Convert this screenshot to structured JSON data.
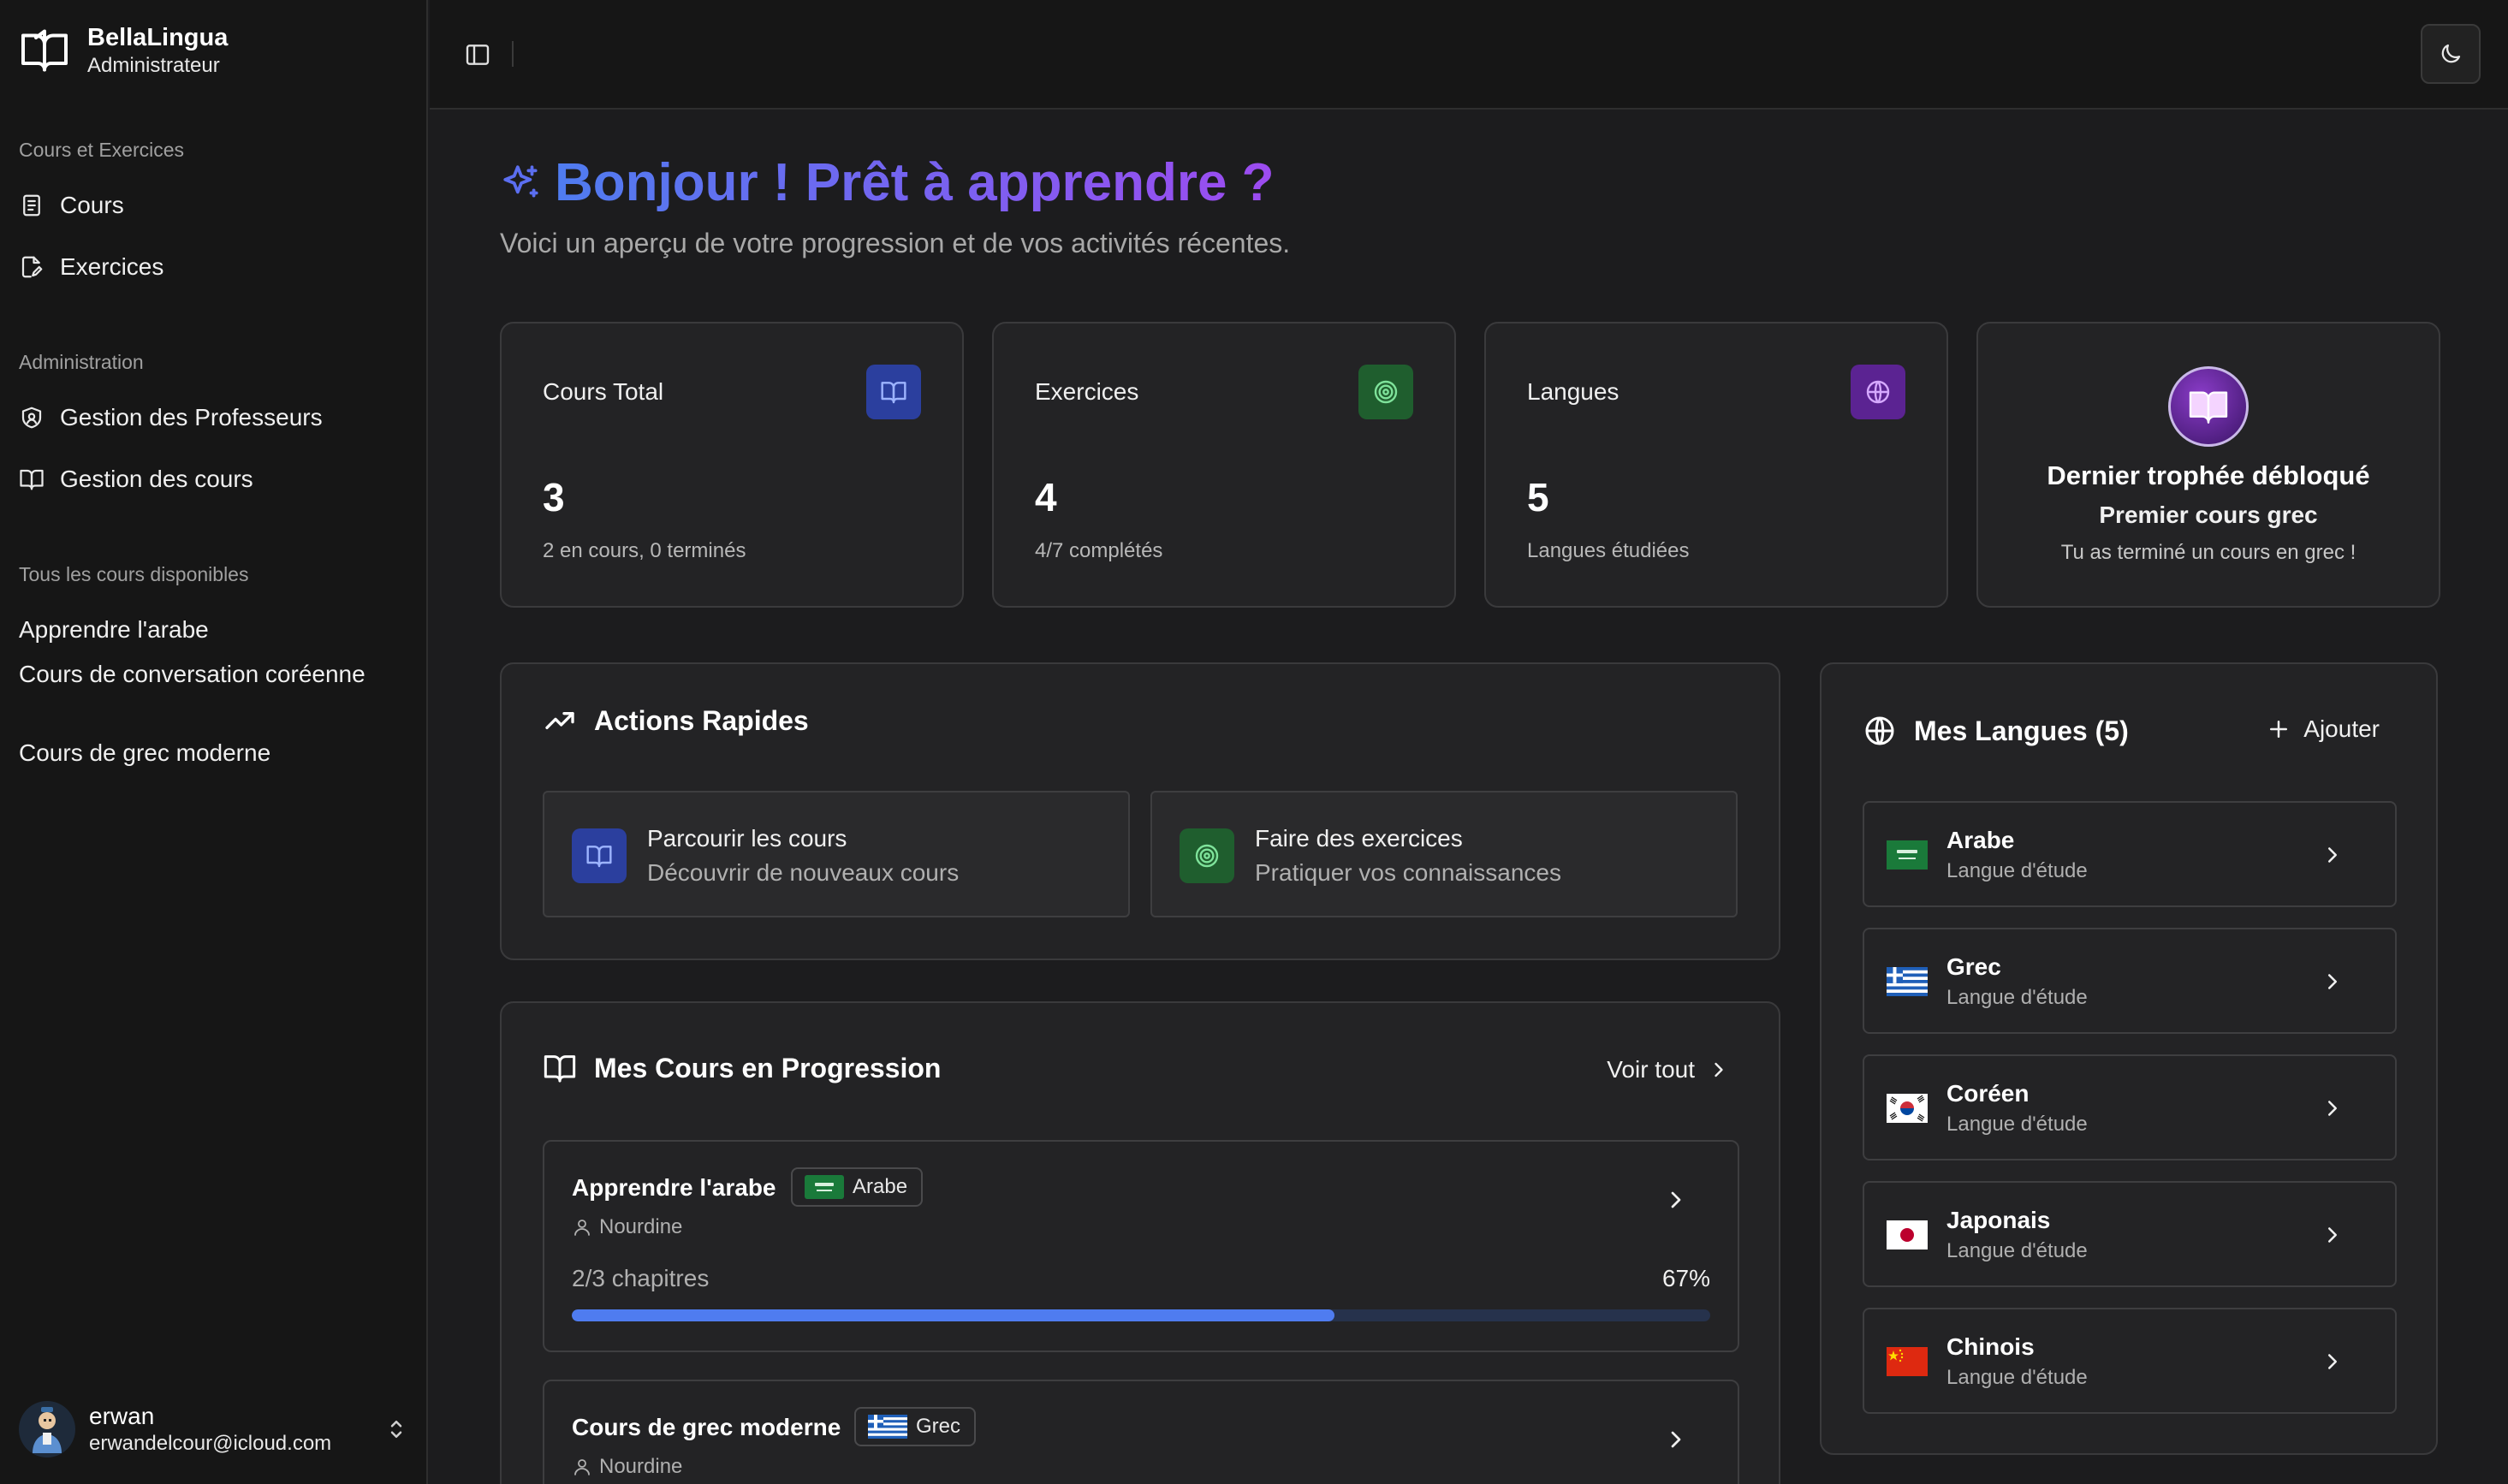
{
  "brand": {
    "name": "BellaLingua",
    "role": "Administrateur"
  },
  "sidebar": {
    "group1_label": "Cours et Exercices",
    "group1_items": [
      {
        "label": "Cours",
        "icon": "document-icon"
      },
      {
        "label": "Exercices",
        "icon": "file-edit-icon"
      }
    ],
    "group2_label": "Administration",
    "group2_items": [
      {
        "label": "Gestion des Professeurs",
        "icon": "shield-icon"
      },
      {
        "label": "Gestion des cours",
        "icon": "book-open-icon"
      }
    ],
    "group3_label": "Tous les cours disponibles",
    "courses": [
      "Apprendre l'arabe",
      "Cours de conversation coréenne",
      "Cours de grec moderne"
    ]
  },
  "user": {
    "name": "erwan",
    "email": "erwandelcour@icloud.com"
  },
  "greeting": {
    "title": "Bonjour ! Prêt à apprendre ?",
    "subtitle": "Voici un aperçu de votre progression et de vos activités récentes."
  },
  "stats": [
    {
      "label": "Cours Total",
      "value": "3",
      "sub": "2 en cours, 0 terminés",
      "color": "#3b5bdb"
    },
    {
      "label": "Exercices",
      "value": "4",
      "sub": "4/7 complétés",
      "color": "#2f9e44"
    },
    {
      "label": "Langues",
      "value": "5",
      "sub": "Langues étudiées",
      "color": "#9c36b5"
    }
  ],
  "trophy": {
    "title": "Dernier trophée débloqué",
    "name": "Premier cours grec",
    "desc": "Tu as terminé un cours en grec !"
  },
  "quick_actions": {
    "title": "Actions Rapides",
    "items": [
      {
        "title": "Parcourir les cours",
        "sub": "Découvrir de nouveaux cours"
      },
      {
        "title": "Faire des exercices",
        "sub": "Pratiquer vos connaissances"
      }
    ]
  },
  "progress": {
    "title": "Mes Cours en Progression",
    "voir_tout": "Voir tout",
    "courses": [
      {
        "name": "Apprendre l'arabe",
        "lang": "Arabe",
        "teacher": "Nourdine",
        "chapters": "2/3 chapitres",
        "pct": "67%",
        "fraction": 0.67
      },
      {
        "name": "Cours de grec moderne",
        "lang": "Grec",
        "teacher": "Nourdine"
      }
    ]
  },
  "languages": {
    "title": "Mes Langues (5)",
    "add": "Ajouter",
    "items": [
      {
        "name": "Arabe",
        "sub": "Langue d'étude"
      },
      {
        "name": "Grec",
        "sub": "Langue d'étude"
      },
      {
        "name": "Coréen",
        "sub": "Langue d'étude"
      },
      {
        "name": "Japonais",
        "sub": "Langue d'étude"
      },
      {
        "name": "Chinois",
        "sub": "Langue d'étude"
      }
    ]
  }
}
